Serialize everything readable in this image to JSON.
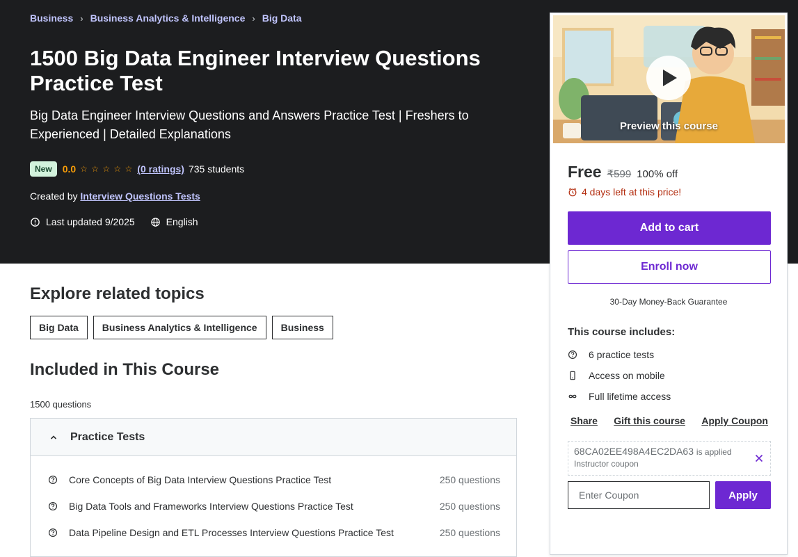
{
  "breadcrumb": [
    "Business",
    "Business Analytics & Intelligence",
    "Big Data"
  ],
  "course": {
    "title": "1500 Big Data Engineer Interview Questions Practice Test",
    "subtitle": "Big Data Engineer Interview Questions and Answers Practice Test | Freshers to Experienced | Detailed Explanations",
    "badge": "New",
    "rating": "0.0",
    "ratings_link": "(0 ratings)",
    "students": "735 students",
    "created_by_label": "Created by",
    "instructor": "Interview Questions Tests",
    "last_updated": "Last updated 9/2025",
    "language": "English"
  },
  "explore": {
    "title": "Explore related topics",
    "topics": [
      "Big Data",
      "Business Analytics & Intelligence",
      "Business"
    ]
  },
  "included": {
    "title": "Included in This Course",
    "question_count": "1500 questions",
    "section_title": "Practice Tests",
    "tests": [
      {
        "label": "Core Concepts of Big Data Interview Questions Practice Test",
        "count": "250 questions"
      },
      {
        "label": "Big Data Tools and Frameworks Interview Questions Practice Test",
        "count": "250 questions"
      },
      {
        "label": "Data Pipeline Design and ETL Processes Interview Questions Practice Test",
        "count": "250 questions"
      }
    ]
  },
  "sidebar": {
    "preview_label": "Preview this course",
    "price": "Free",
    "original_price": "₹599",
    "discount": "100% off",
    "timer": "4 days left at this price!",
    "add_to_cart": "Add to cart",
    "enroll_now": "Enroll now",
    "guarantee": "30-Day Money-Back Guarantee",
    "includes_title": "This course includes:",
    "includes": [
      "6 practice tests",
      "Access on mobile",
      "Full lifetime access"
    ],
    "links": [
      "Share",
      "Gift this course",
      "Apply Coupon"
    ],
    "coupon_code": "68CA02EE498A4EC2DA63",
    "coupon_applied": "is applied",
    "coupon_sub": "Instructor coupon",
    "coupon_placeholder": "Enter Coupon",
    "apply_label": "Apply"
  },
  "colors": {
    "hero_bg": "#1c1d1f",
    "link_purple": "#c0c4fc",
    "accent": "#6d28d2",
    "star": "#f69c08",
    "timer": "#b32d0f"
  }
}
